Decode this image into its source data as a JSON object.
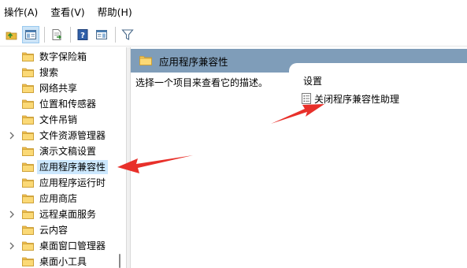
{
  "menu": [
    "操作(A)",
    "查看(V)",
    "帮助(H)"
  ],
  "toolbar": {
    "buttons": [
      "up-folder-icon",
      "show-hide-tree-icon",
      "export-list-icon",
      "help-icon",
      "properties-pane-icon",
      "filter-icon"
    ]
  },
  "tree": {
    "items": [
      {
        "label": "数字保险箱",
        "expandable": false,
        "selected": false
      },
      {
        "label": "搜索",
        "expandable": false,
        "selected": false
      },
      {
        "label": "网络共享",
        "expandable": false,
        "selected": false
      },
      {
        "label": "位置和传感器",
        "expandable": false,
        "selected": false
      },
      {
        "label": "文件吊销",
        "expandable": false,
        "selected": false
      },
      {
        "label": "文件资源管理器",
        "expandable": true,
        "selected": false
      },
      {
        "label": "演示文稿设置",
        "expandable": false,
        "selected": false
      },
      {
        "label": "应用程序兼容性",
        "expandable": false,
        "selected": true
      },
      {
        "label": "应用程序运行时",
        "expandable": false,
        "selected": false
      },
      {
        "label": "应用商店",
        "expandable": false,
        "selected": false
      },
      {
        "label": "远程桌面服务",
        "expandable": true,
        "selected": false
      },
      {
        "label": "云内容",
        "expandable": false,
        "selected": false
      },
      {
        "label": "桌面窗口管理器",
        "expandable": true,
        "selected": false
      },
      {
        "label": "桌面小工具",
        "expandable": false,
        "selected": false
      }
    ]
  },
  "right": {
    "title": "应用程序兼容性",
    "description": "选择一个项目来查看它的描述。",
    "column_header": "设置",
    "settings": [
      {
        "label": "关闭程序兼容性助理",
        "icon": "policy-setting-icon"
      }
    ]
  },
  "colors": {
    "header_bg": "#7f9db9",
    "selection_bg": "#cce8ff",
    "folder": "#f5c85a",
    "arrow": "#e8302a"
  }
}
